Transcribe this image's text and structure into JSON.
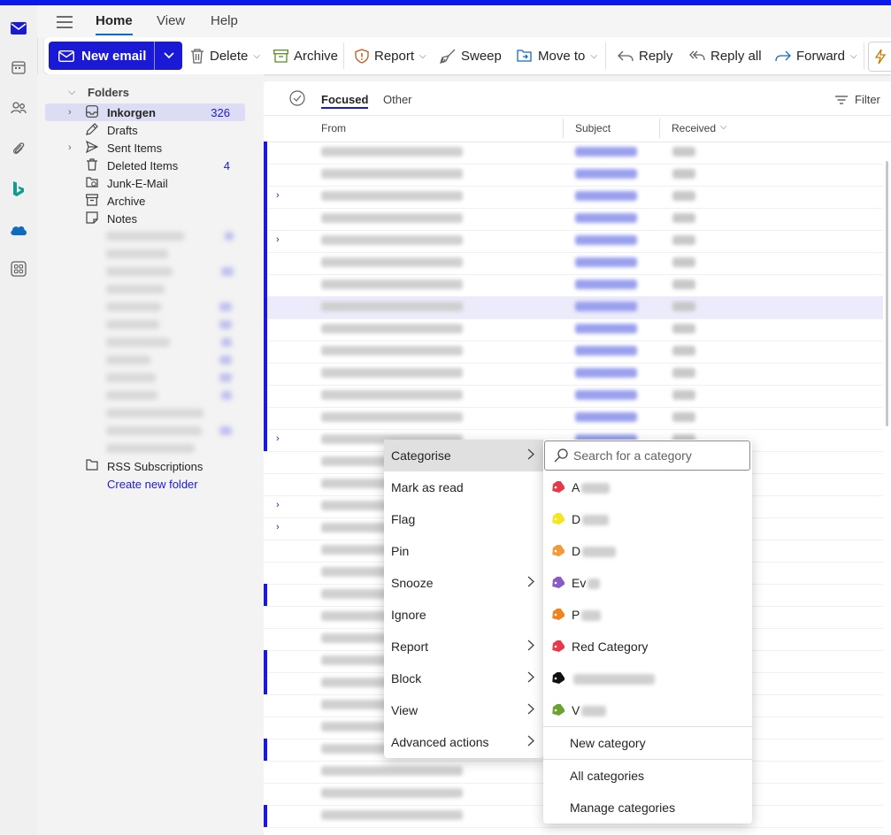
{
  "ribbon_tabs": [
    {
      "label": "Home",
      "active": true
    },
    {
      "label": "View"
    },
    {
      "label": "Help"
    }
  ],
  "toolbar": {
    "new_email": "New email",
    "delete": "Delete",
    "archive": "Archive",
    "report": "Report",
    "sweep": "Sweep",
    "move_to": "Move to",
    "reply": "Reply",
    "reply_all": "Reply all",
    "forward": "Forward"
  },
  "folders": {
    "header": "Folders",
    "items": [
      {
        "name": "Inkorgen",
        "count": "326",
        "icon": "inbox-icon"
      },
      {
        "name": "Drafts",
        "count": "",
        "icon": "pencil-icon"
      },
      {
        "name": "Sent Items",
        "count": "",
        "icon": "send-icon"
      },
      {
        "name": "Deleted Items",
        "count": "4",
        "icon": "trash-icon"
      },
      {
        "name": "Junk-E-Mail",
        "count": "",
        "icon": "junk-icon"
      },
      {
        "name": "Archive",
        "count": "",
        "icon": "archive-icon"
      },
      {
        "name": "Notes",
        "count": "",
        "icon": "note-icon"
      }
    ],
    "rss": "RSS Subscriptions",
    "create_new": "Create new folder"
  },
  "mail_list": {
    "tab_focused": "Focused",
    "tab_other": "Other",
    "filter": "Filter",
    "col_from": "From",
    "col_subject": "Subject",
    "col_received": "Received"
  },
  "context_menu": [
    {
      "label": "Categorise",
      "submenu": true
    },
    {
      "label": "Mark as read",
      "submenu": false
    },
    {
      "label": "Flag",
      "submenu": false
    },
    {
      "label": "Pin",
      "submenu": false
    },
    {
      "label": "Snooze",
      "submenu": true
    },
    {
      "label": "Ignore",
      "submenu": false
    },
    {
      "label": "Report",
      "submenu": true
    },
    {
      "label": "Block",
      "submenu": true
    },
    {
      "label": "View",
      "submenu": true
    },
    {
      "label": "Advanced actions",
      "submenu": true
    }
  ],
  "categories_menu": {
    "search_placeholder": "Search for a category",
    "categories": [
      {
        "name": "A",
        "color": "#e8394a"
      },
      {
        "name": "D",
        "color": "#f5e51b"
      },
      {
        "name": "D",
        "color": "#f59a3a"
      },
      {
        "name": "Ev",
        "color": "#8a5ac7"
      },
      {
        "name": "P",
        "color": "#f08220"
      },
      {
        "name": "Red Category",
        "color": "#e8394a"
      },
      {
        "name": "",
        "color": "#111111"
      },
      {
        "name": "V",
        "color": "#6aa331"
      }
    ],
    "new_category": "New category",
    "all_categories": "All categories",
    "manage_categories": "Manage categories"
  },
  "colors": {
    "accent": "#1a1ad6",
    "top_bar": "#0a1ae8"
  }
}
